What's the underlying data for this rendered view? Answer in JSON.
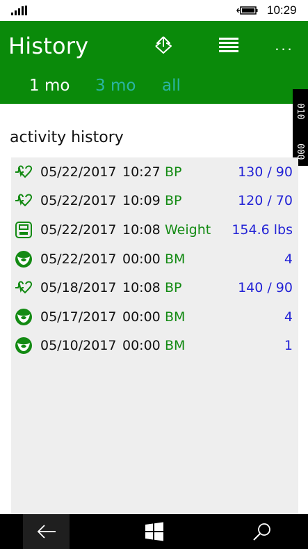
{
  "status_bar": {
    "time": "10:29",
    "icons": [
      "signal-icon",
      "battery-icon"
    ]
  },
  "header": {
    "title": "History",
    "actions": [
      "upload-icon",
      "list-icon",
      "more-icon"
    ],
    "more_label": "...",
    "tabs": [
      {
        "label": "1 mo",
        "selected": true
      },
      {
        "label": "3 mo",
        "selected": false
      },
      {
        "label": "all",
        "selected": false
      }
    ]
  },
  "side_tab": {
    "line1": "010",
    "line2": "000"
  },
  "section": {
    "title": "activity history"
  },
  "history": {
    "rows": [
      {
        "icon": "heart-pulse-icon",
        "date": "05/22/2017",
        "time": "10:27",
        "type": "BP",
        "value": "130 / 90"
      },
      {
        "icon": "heart-pulse-icon",
        "date": "05/22/2017",
        "time": "10:09",
        "type": "BP",
        "value": "120 / 70"
      },
      {
        "icon": "scale-icon",
        "date": "05/22/2017",
        "time": "10:08",
        "type": "Weight",
        "value": "154.6 lbs"
      },
      {
        "icon": "bm-icon",
        "date": "05/22/2017",
        "time": "00:00",
        "type": "BM",
        "value": "4"
      },
      {
        "icon": "heart-pulse-icon",
        "date": "05/18/2017",
        "time": "10:08",
        "type": "BP",
        "value": "140 / 90"
      },
      {
        "icon": "bm-icon",
        "date": "05/17/2017",
        "time": "00:00",
        "type": "BM",
        "value": "4"
      },
      {
        "icon": "bm-icon",
        "date": "05/10/2017",
        "time": "00:00",
        "type": "BM",
        "value": "1"
      }
    ]
  },
  "nav_bar": {
    "buttons": [
      "back-arrow-icon",
      "windows-icon",
      "search-icon"
    ]
  },
  "colors": {
    "header_bg": "#0a8a0a",
    "tab_inactive": "#2ab5a3",
    "type_text": "#138a13",
    "value_text": "#2323d6",
    "list_bg": "#eeeeee"
  }
}
